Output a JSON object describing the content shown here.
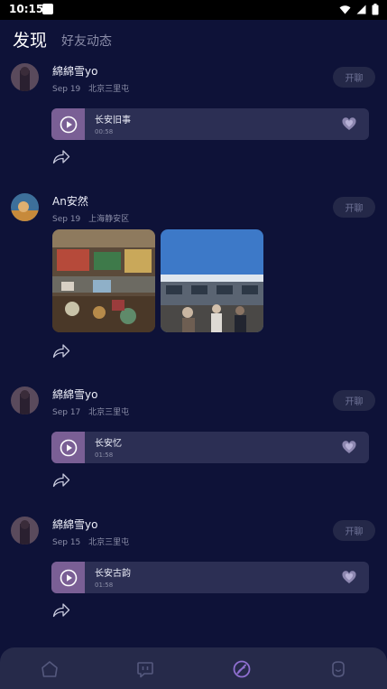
{
  "status_bar": {
    "time": "10:15"
  },
  "header": {
    "tab_discover": "发现",
    "tab_friends": "好友动态"
  },
  "posts": [
    {
      "username": "綿綿雪yo",
      "date": "Sep 19",
      "location": "北京三里屯",
      "chat_label": "开聊",
      "audio": {
        "title": "长安旧事",
        "duration": "00:58"
      }
    },
    {
      "username": "An安然",
      "date": "Sep 19",
      "location": "上海静安区",
      "chat_label": "开聊"
    },
    {
      "username": "綿綿雪yo",
      "date": "Sep 17",
      "location": "北京三里屯",
      "chat_label": "开聊",
      "audio": {
        "title": "长安忆",
        "duration": "01:58"
      }
    },
    {
      "username": "綿綿雪yo",
      "date": "Sep 15",
      "location": "北京三里屯",
      "chat_label": "开聊",
      "audio": {
        "title": "长安古韵",
        "duration": "01:58"
      }
    }
  ],
  "bottom_nav": {
    "items": [
      "home-icon",
      "message-icon",
      "discover-icon",
      "profile-icon"
    ],
    "active": "discover-icon"
  },
  "colors": {
    "background": "#0e1238",
    "accent": "#8f6fd0",
    "audio_play": "#7a5f95"
  }
}
